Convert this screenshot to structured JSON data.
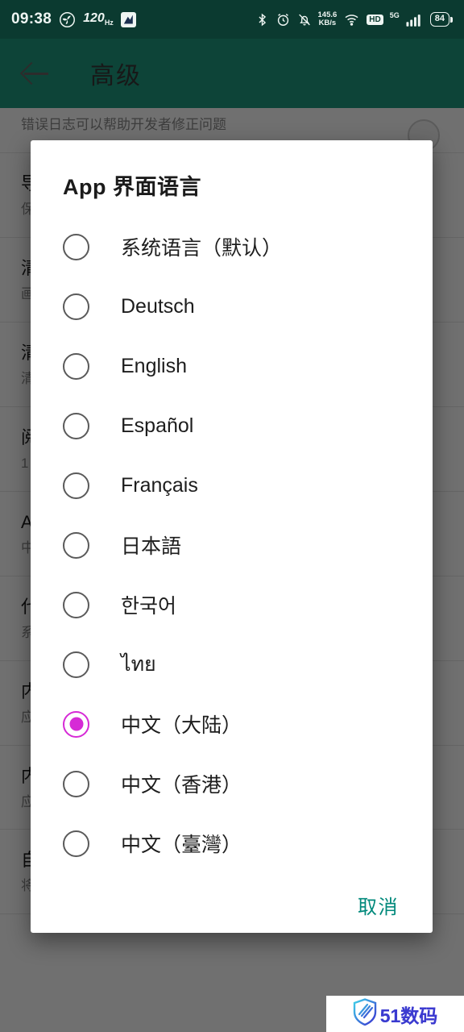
{
  "status_bar": {
    "time": "09:38",
    "refresh_rate": "120",
    "refresh_rate_unit": "Hz",
    "network_speed_value": "145.6",
    "network_speed_unit": "KB/s",
    "hd_label": "HD",
    "network_type": "5G",
    "battery_level": "84",
    "icons": [
      "fan-icon",
      "sim-card-icon",
      "bluetooth-icon",
      "alarm-clock-icon",
      "bell-muted-icon",
      "wifi-icon",
      "signal-bars-icon"
    ]
  },
  "app_bar": {
    "title": "高级",
    "back_icon": "back-arrow-icon"
  },
  "background_settings": {
    "rows": [
      {
        "title": "",
        "subtitle": "错误日志可以帮助开发者修正问题",
        "has_switch": true
      },
      {
        "title": "导出日志",
        "subtitle": "保存到文件",
        "has_switch": false
      },
      {
        "title": "清理缓存",
        "subtitle": "画质缓存\n载入缓存",
        "has_switch": false
      },
      {
        "title": "清理数据",
        "subtitle": "清除全部应用数据",
        "has_switch": false
      },
      {
        "title": "阅读缓冲页数",
        "subtitle": "1",
        "has_switch": false
      },
      {
        "title": "App 界面语言",
        "subtitle": "中文（大陆）",
        "has_switch": false
      },
      {
        "title": "代理设置",
        "subtitle": "系统代理",
        "has_switch": false
      },
      {
        "title": "内置 hosts.txt",
        "subtitle": "应用内置的 hosts 文件\n可被自定义 hosts.txt 覆盖",
        "has_switch": false
      },
      {
        "title": "内置 DNS",
        "subtitle": "应用内置的 DNS 解析\n可被自定义 hosts.txt 覆盖",
        "has_switch": false
      },
      {
        "title": "自定义 hosts.txt",
        "subtitle": "将主机名称映射到相应的IP地址",
        "has_switch": false
      }
    ]
  },
  "dialog": {
    "title": "App 界面语言",
    "selected_index": 8,
    "accent_color": "#d62ad6",
    "cancel_color": "#00897b",
    "options": [
      {
        "label": "系统语言（默认）",
        "selected": false
      },
      {
        "label": "Deutsch",
        "selected": false
      },
      {
        "label": "English",
        "selected": false
      },
      {
        "label": "Español",
        "selected": false
      },
      {
        "label": "Français",
        "selected": false
      },
      {
        "label": "日本語",
        "selected": false
      },
      {
        "label": "한국어",
        "selected": false
      },
      {
        "label": "ไทย",
        "selected": false
      },
      {
        "label": "中文（大陆）",
        "selected": true
      },
      {
        "label": "中文（香港）",
        "selected": false
      },
      {
        "label": "中文（臺灣）",
        "selected": false
      }
    ],
    "cancel_label": "取消"
  },
  "watermark": {
    "text": "51数码",
    "icon": "shield-logo-icon"
  }
}
